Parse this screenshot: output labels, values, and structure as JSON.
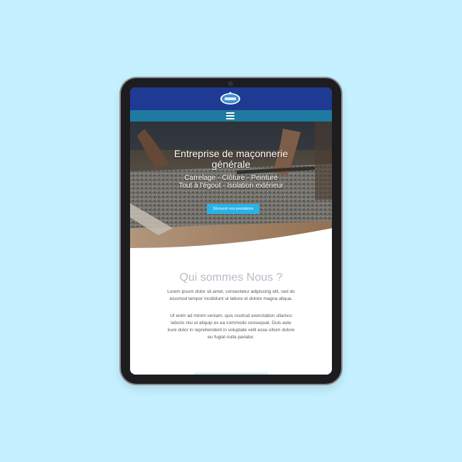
{
  "colors": {
    "background": "#c4f0ff",
    "header": "#1f3a93",
    "navbar": "#1e7a9f",
    "cta": "#2ab2e8",
    "title_gray": "#b8bcc6",
    "text_gray": "#555a63"
  },
  "header": {
    "logo_icon": "company-logo-icon"
  },
  "navbar": {
    "menu_icon": "hamburger-menu-icon"
  },
  "hero": {
    "title": "Entreprise de maçonnerie générale",
    "subtitle_lines": [
      "Carrelage - Clôture - Peinture",
      "Tout à l'égout - Isolation extérieur"
    ],
    "cta_label": "Découvrir nos prestations"
  },
  "about": {
    "title": "Qui sommes Nous ?",
    "paragraphs": [
      "Lorem ipsum dolor sit amet, consectetur adipiscing elit, sed do eiusmod tempor incididunt ut labore et dolore magna aliqua.",
      "Ut enim ad minim veniam, quis nostrud exercitation ullamco laboris nisi ut aliquip ex ea commodo consequat. Duis aute irure dolor in reprehenderit in voluptate velit esse cillum dolore eu fugiat nulla pariatur."
    ]
  }
}
